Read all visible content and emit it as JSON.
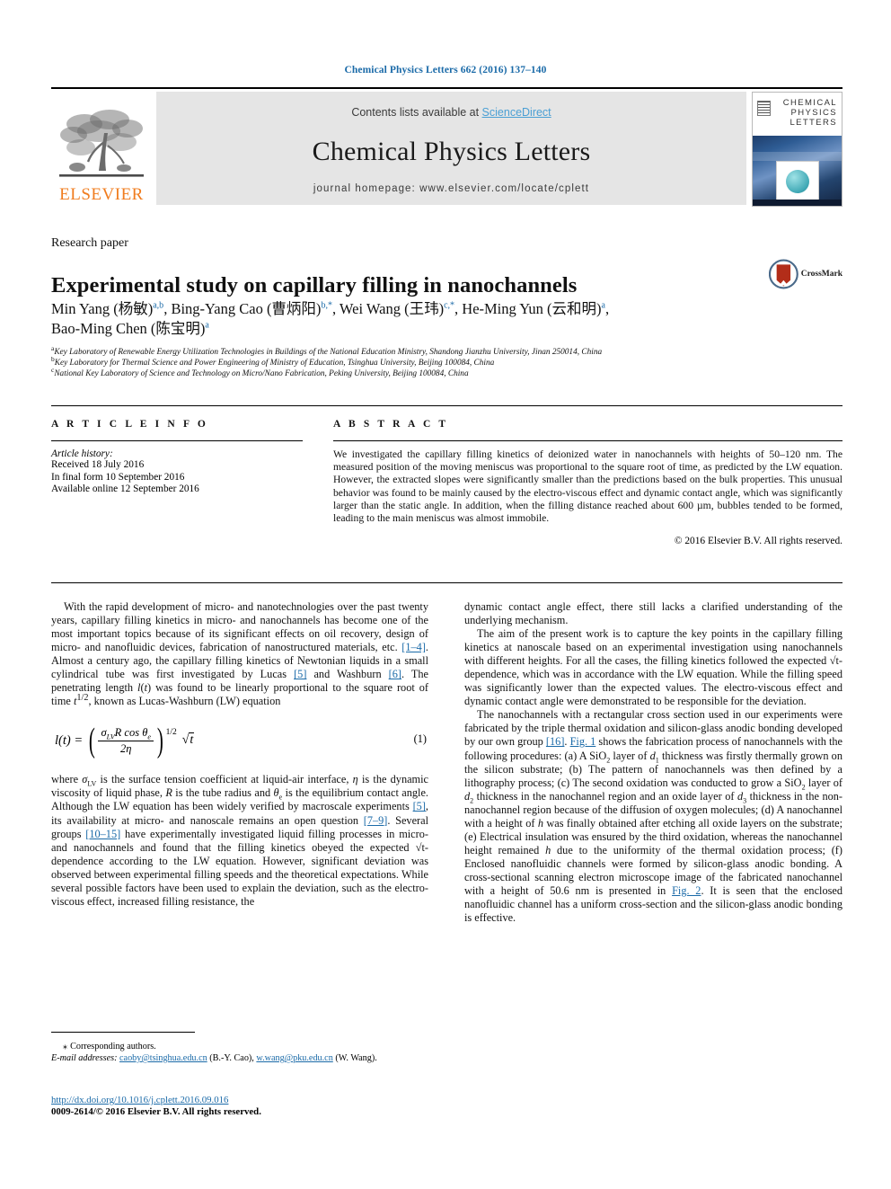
{
  "running_head": "Chemical Physics Letters 662 (2016) 137–140",
  "masthead": {
    "contents_prefix": "Contents lists available at ",
    "sciencedirect": "ScienceDirect",
    "journal_name": "Chemical Physics Letters",
    "homepage": "journal homepage: www.elsevier.com/locate/cplett",
    "publisher": "ELSEVIER",
    "cover_title_lines": [
      "CHEMICAL",
      "PHYSICS",
      "LETTERS"
    ]
  },
  "article": {
    "section_label": "Research paper",
    "title": "Experimental study on capillary filling in nanochannels",
    "crossmark_label": "CrossMark",
    "authors_html": "Min Yang (杨敏)<sup>a,b</sup>, Bing-Yang Cao (曹炳阳)<sup>b,*</sup>, Wei Wang (王玮)<sup>c,*</sup>, He-Ming Yun (云和明)<sup>a</sup>, Bao-Ming Chen (陈宝明)<sup>a</sup>",
    "affiliations": [
      {
        "mark": "a",
        "text": "Key Laboratory of Renewable Energy Utilization Technologies in Buildings of the National Education Ministry, Shandong Jianzhu University, Jinan 250014, China"
      },
      {
        "mark": "b",
        "text": "Key Laboratory for Thermal Science and Power Engineering of Ministry of Education, Tsinghua University, Beijing 100084, China"
      },
      {
        "mark": "c",
        "text": "National Key Laboratory of Science and Technology on Micro/Nano Fabrication, Peking University, Beijing 100084, China"
      }
    ]
  },
  "article_info": {
    "heading": "A R T I C L E    I N F O",
    "history_label": "Article history:",
    "history": [
      "Received 18 July 2016",
      "In final form 10 September 2016",
      "Available online 12 September 2016"
    ]
  },
  "abstract": {
    "heading": "A B S T R A C T",
    "text": "We investigated the capillary filling kinetics of deionized water in nanochannels with heights of 50–120 nm. The measured position of the moving meniscus was proportional to the square root of time, as predicted by the LW equation. However, the extracted slopes were significantly smaller than the predictions based on the bulk properties. This unusual behavior was found to be mainly caused by the electro-viscous effect and dynamic contact angle, which was significantly larger than the static angle. In addition, when the filling distance reached about 600 µm, bubbles tended to be formed, leading to the main meniscus was almost immobile.",
    "copyright": "© 2016 Elsevier B.V. All rights reserved."
  },
  "body": {
    "left_p1_a": "With the rapid development of micro- and nanotechnologies over the past twenty years, capillary filling kinetics in micro- and nanochannels has become one of the most important topics because of its significant effects on oil recovery, design of micro- and nanofluidic devices, fabrication of nanostructured materials, etc. ",
    "ref_1_4": "[1–4]",
    "left_p1_b": ". Almost a century ago, the capillary filling kinetics of Newtonian liquids in a small cylindrical tube was first investigated by Lucas ",
    "ref_5a": "[5]",
    "left_p1_c": " and Washburn ",
    "ref_6": "[6]",
    "left_p1_d": ". The penetrating length l(t) was found to be linearly proportional to the square root of time t",
    "left_p1_e": ", known as Lucas-Washburn (LW) equation",
    "equation": {
      "lhs": "l(t) =",
      "numerator": "σLVR cos θe",
      "denominator": "2η",
      "exponent": "1/2",
      "radical": "√t",
      "number": "(1)"
    },
    "left_p2_a": "where σLV is the surface tension coefficient at liquid-air interface, η is the dynamic viscosity of liquid phase, R is the tube radius and θe is the equilibrium contact angle. Although the LW equation has been widely verified by macroscale experiments ",
    "ref_5b": "[5]",
    "left_p2_b": ", its availability at micro- and nanoscale remains an open question ",
    "ref_7_9": "[7–9]",
    "left_p2_c": ". Several groups ",
    "ref_10_15": "[10–15]",
    "left_p2_d": " have experimentally investigated liquid filling processes in micro- and nanochannels and found that the filling kinetics obeyed the expected √t-dependence according to the LW equation. However, significant deviation was observed between experimental filling speeds and the theoretical expectations. While several possible factors have been used to explain the deviation, such as the electro-viscous effect, increased filling resistance, the",
    "right_p1": "dynamic contact angle effect, there still lacks a clarified understanding of the underlying mechanism.",
    "right_p2": "The aim of the present work is to capture the key points in the capillary filling kinetics at nanoscale based on an experimental investigation using nanochannels with different heights. For all the cases, the filling kinetics followed the expected √t-dependence, which was in accordance with the LW equation. While the filling speed was significantly lower than the expected values. The electro-viscous effect and dynamic contact angle were demonstrated to be responsible for the deviation.",
    "right_p3_a": "The nanochannels with a rectangular cross section used in our experiments were fabricated by the triple thermal oxidation and silicon-glass anodic bonding developed by our own group ",
    "ref_16": "[16]",
    "right_p3_b": ". ",
    "ref_fig1": "Fig. 1",
    "right_p3_c": " shows the fabrication process of nanochannels with the following procedures: (a) A SiO2 layer of d1 thickness was firstly thermally grown on the silicon substrate; (b) The pattern of nanochannels was then defined by a lithography process; (c) The second oxidation was conducted to grow a SiO2 layer of d2 thickness in the nanochannel region and an oxide layer of d3 thickness in the non-nanochannel region because of the diffusion of oxygen molecules; (d) A nanochannel with a height of h was finally obtained after etching all oxide layers on the substrate; (e) Electrical insulation was ensured by the third oxidation, whereas the nanochannel height remained h due to the uniformity of the thermal oxidation process; (f) Enclosed nanofluidic channels were formed by silicon-glass anodic bonding. A cross-sectional scanning electron microscope image of the fabricated nanochannel with a height of 50.6 nm is presented in ",
    "ref_fig2": "Fig. 2",
    "right_p3_d": ". It is seen that the enclosed nanofluidic channel has a uniform cross-section and the silicon-glass anodic bonding is effective."
  },
  "footnotes": {
    "corresponding": "Corresponding authors.",
    "email_label": "E-mail addresses:",
    "email1": "caoby@tsinghua.edu.cn",
    "email1_owner": "(B.-Y. Cao),",
    "email2": "w.wang@pku.edu.cn",
    "email2_owner": "(W. Wang)."
  },
  "footer": {
    "doi": "http://dx.doi.org/10.1016/j.cplett.2016.09.016",
    "issn_line": "0009-2614/© 2016 Elsevier B.V. All rights reserved."
  },
  "colors": {
    "link_blue": "#1a6aa8",
    "sciencedirect_blue": "#4a9fd4",
    "elsevier_orange": "#f07c1e",
    "band_gray": "#e5e5e5"
  }
}
